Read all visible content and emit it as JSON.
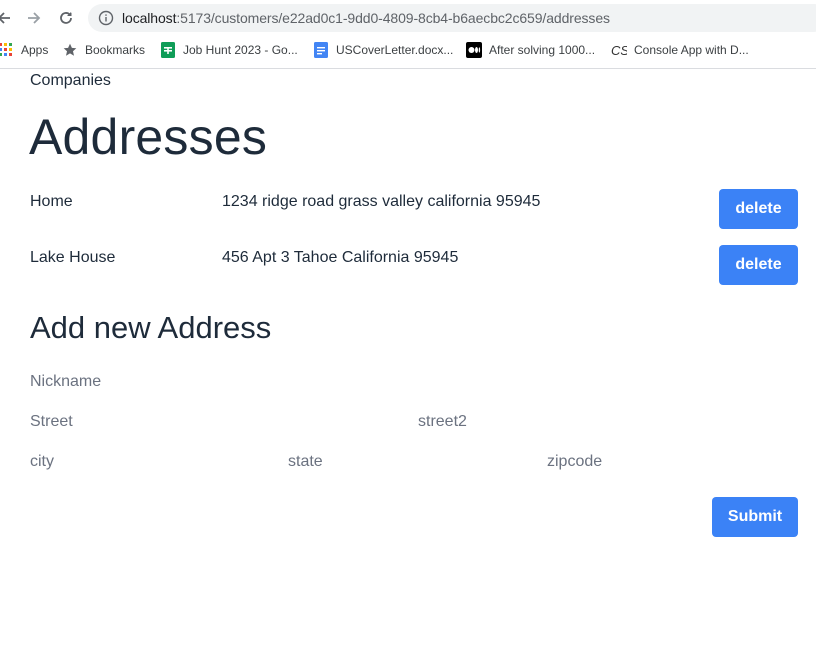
{
  "browser": {
    "url_host": "localhost",
    "url_rest": ":5173/customers/e22ad0c1-9dd0-4809-8cb4-b6aecbc2c659/addresses",
    "bookmarks": [
      {
        "label": "Apps",
        "icon": "apps-grid-icon"
      },
      {
        "label": "Bookmarks",
        "icon": "star-icon"
      },
      {
        "label": "Job Hunt 2023 - Go...",
        "icon": "sheets-icon"
      },
      {
        "label": "USCoverLetter.docx...",
        "icon": "docs-icon"
      },
      {
        "label": "After solving 1000...",
        "icon": "medium-icon"
      },
      {
        "label": "Console App with D...",
        "icon": "cs-icon"
      }
    ]
  },
  "nav": {
    "companies_label": "Companies"
  },
  "page": {
    "title": "Addresses"
  },
  "addresses": [
    {
      "nickname": "Home",
      "full": "1234 ridge road grass valley california 95945",
      "delete_label": "delete"
    },
    {
      "nickname": "Lake House",
      "full": "456 Apt 3 Tahoe California 95945",
      "delete_label": "delete"
    }
  ],
  "form": {
    "title": "Add new Address",
    "nickname_placeholder": "Nickname",
    "street_placeholder": "Street",
    "street2_placeholder": "street2",
    "city_placeholder": "city",
    "state_placeholder": "state",
    "zipcode_placeholder": "zipcode",
    "submit_label": "Submit"
  },
  "colors": {
    "accent": "#3b82f6",
    "text": "#1e2b3a",
    "placeholder": "#6b7280"
  }
}
